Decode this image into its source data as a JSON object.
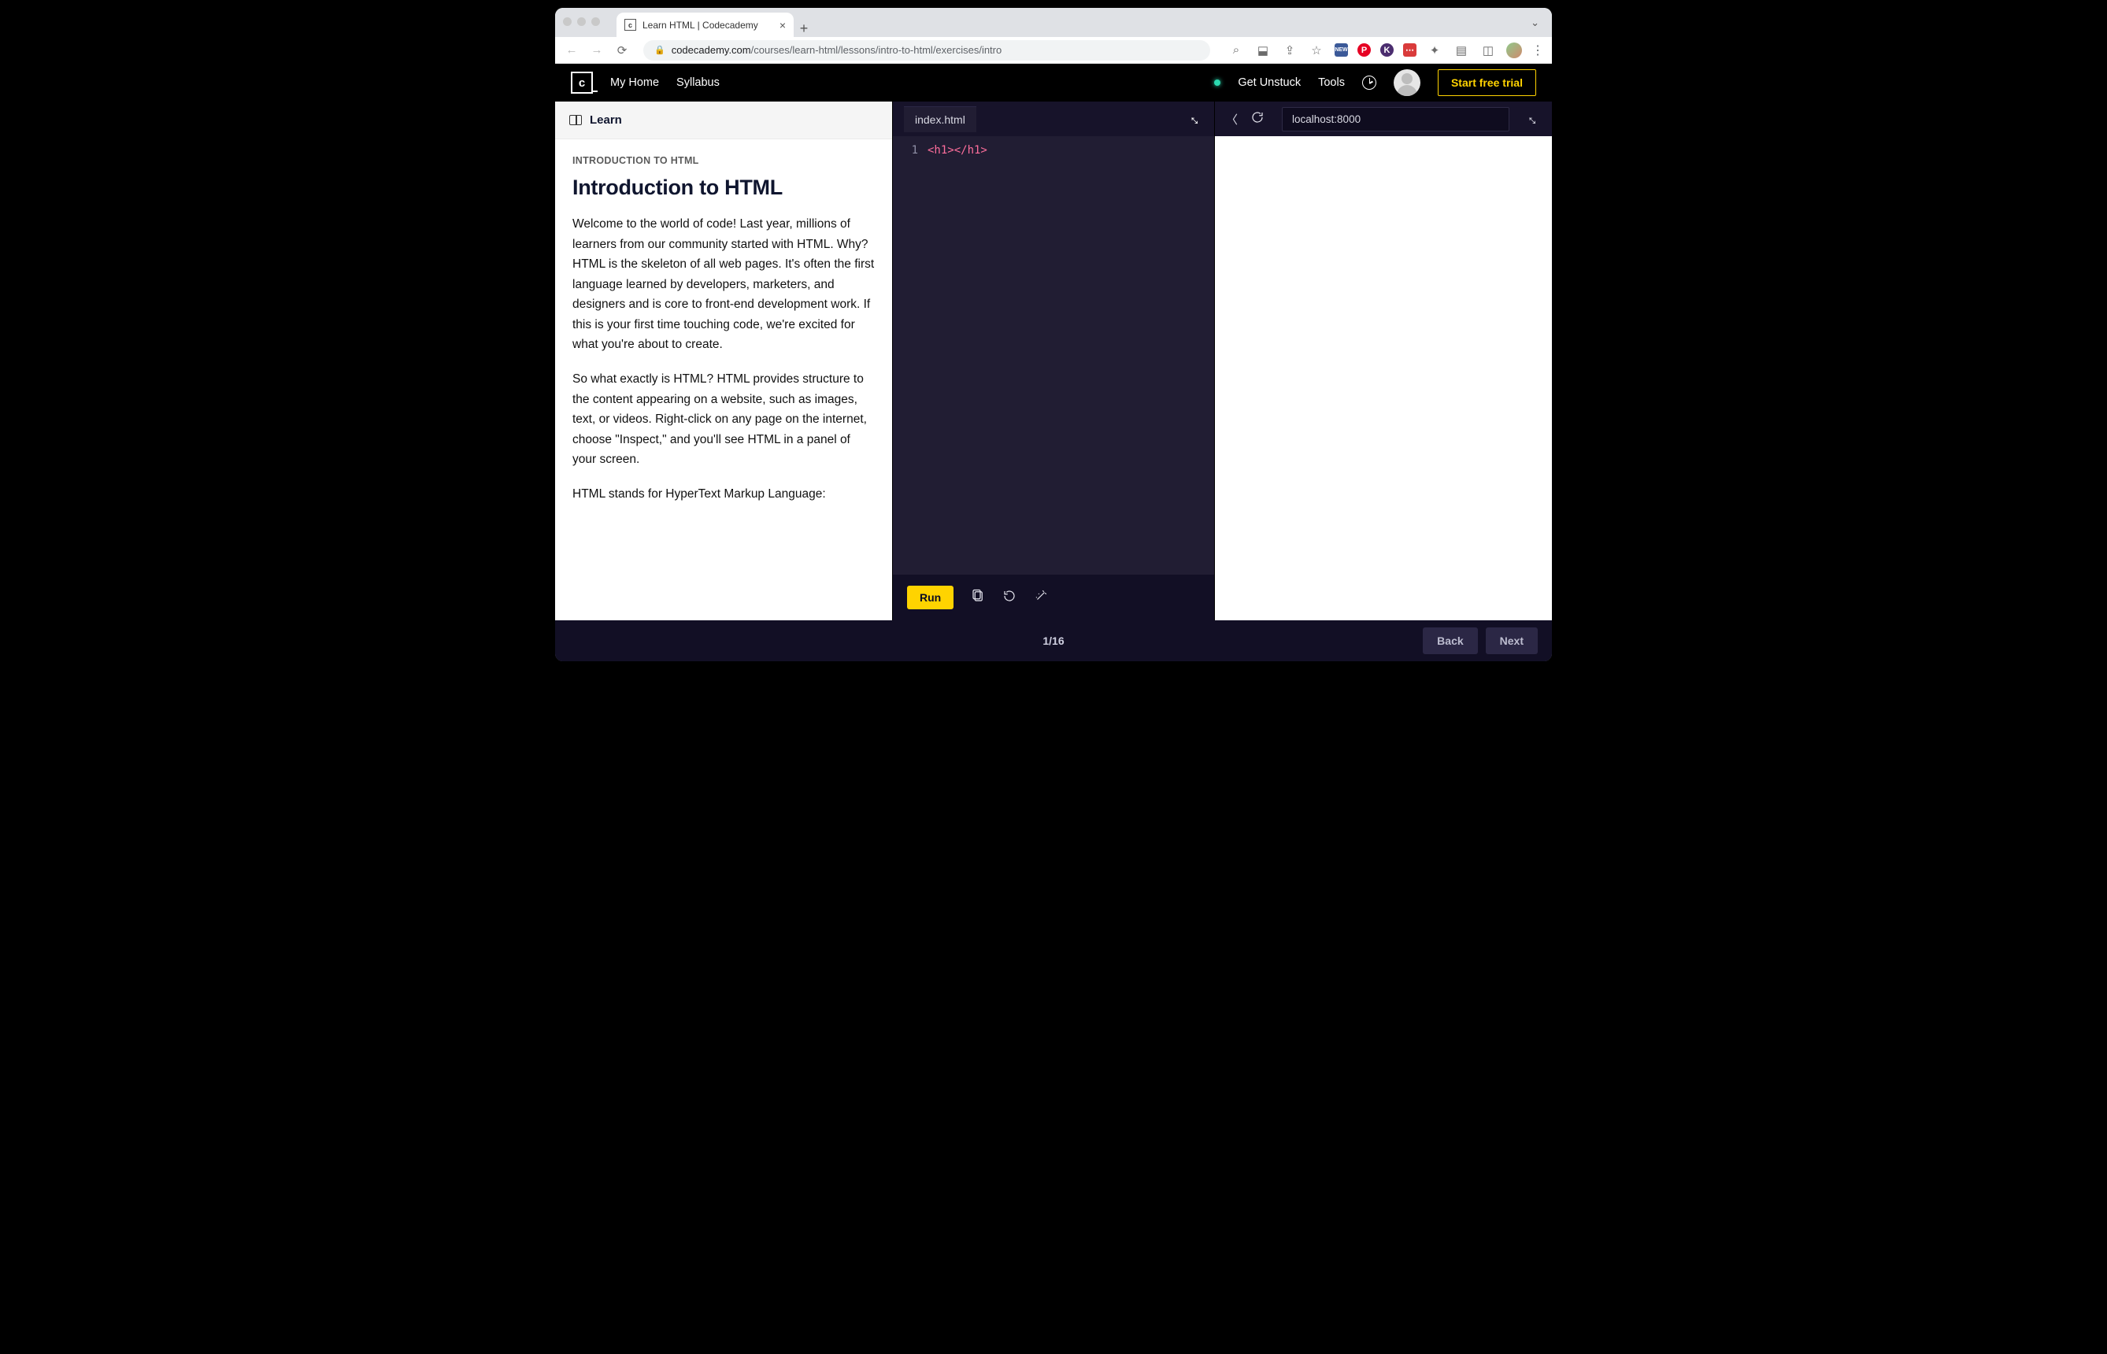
{
  "browser": {
    "tab_title": "Learn HTML | Codecademy",
    "url_domain": "codecademy.com",
    "url_path": "/courses/learn-html/lessons/intro-to-html/exercises/intro",
    "ext_icons": [
      "search",
      "download",
      "share",
      "star",
      "new",
      "pinterest",
      "k",
      "more",
      "puzzle",
      "media",
      "panel"
    ]
  },
  "header": {
    "nav": {
      "home": "My Home",
      "syllabus": "Syllabus"
    },
    "get_unstuck": "Get Unstuck",
    "tools": "Tools",
    "cta": "Start free trial"
  },
  "sidebar": {
    "section_label": "Learn",
    "eyebrow": "INTRODUCTION TO HTML",
    "title": "Introduction to HTML",
    "para1": "Welcome to the world of code! Last year, millions of learners from our community started with HTML. Why? HTML is the skeleton of all web pages. It's often the first language learned by developers, marketers, and designers and is core to front-end development work. If this is your first time touching code, we're excited for what you're about to create.",
    "para2": "So what exactly is HTML? HTML provides structure to the content appearing on a website, such as images, text, or videos. Right-click on any page on the internet, choose \"Inspect,\" and you'll see HTML in a panel of your screen.",
    "para3": "HTML stands for HyperText Markup Language:"
  },
  "editor": {
    "filename": "index.html",
    "line_number": "1",
    "code_line": "<h1></h1>",
    "run_label": "Run"
  },
  "preview": {
    "url": "localhost:8000"
  },
  "footer": {
    "progress": "1/16",
    "back": "Back",
    "next": "Next"
  }
}
